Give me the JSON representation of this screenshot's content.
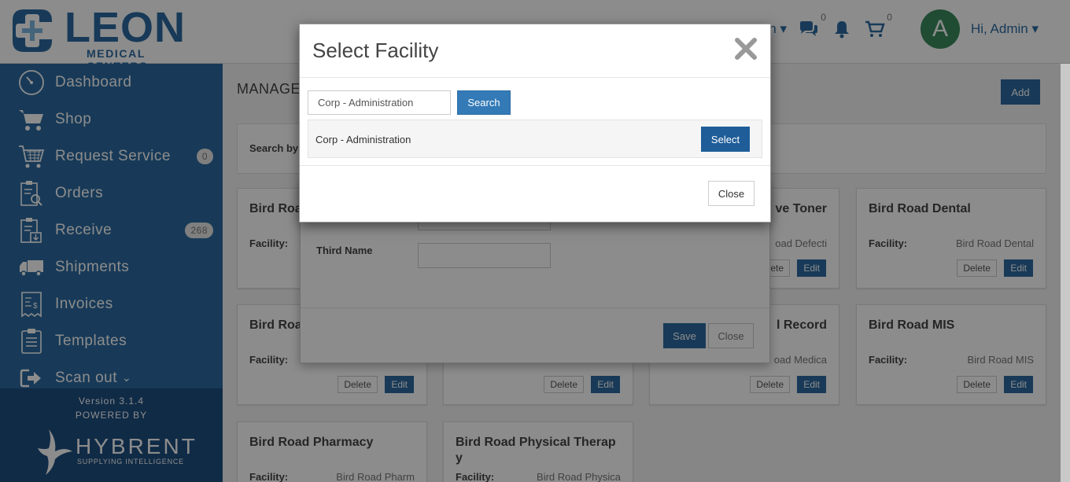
{
  "header": {
    "logo_word": "LEON",
    "logo_sub": "MEDICAL CENTERS",
    "partial_menu": "in",
    "messages_count": "0",
    "cart_count": "0",
    "avatar_letter": "A",
    "greeting": "Hi, Admin"
  },
  "sidebar": {
    "items": [
      {
        "label": "Dashboard",
        "icon": "dashboard-icon"
      },
      {
        "label": "Shop",
        "icon": "cart-icon"
      },
      {
        "label": "Request Service",
        "icon": "request-cart-icon",
        "badge": "0"
      },
      {
        "label": "Orders",
        "icon": "orders-icon"
      },
      {
        "label": "Receive",
        "icon": "receive-icon",
        "badge": "268"
      },
      {
        "label": "Shipments",
        "icon": "truck-icon"
      },
      {
        "label": "Invoices",
        "icon": "invoice-icon"
      },
      {
        "label": "Templates",
        "icon": "clipboard-icon"
      },
      {
        "label": "Scan out",
        "icon": "sign-out-icon"
      }
    ],
    "version": "Version 3.1.4",
    "powered_by": "POWERED BY",
    "hybrent": "HYBRENT",
    "hybrent_sub": "SUPPLYING INTELLIGENCE"
  },
  "main": {
    "title_partial": "MANAGE",
    "add_label": "Add",
    "search_label_partial": "Search by",
    "facility_label": "Facility:",
    "delete_label": "Delete",
    "edit_label": "Edit",
    "cards": [
      {
        "title": "Bird Roa",
        "facility": ""
      },
      {
        "title": "",
        "facility": ""
      },
      {
        "title": "ve Toner",
        "facility": "oad Defecti"
      },
      {
        "title": "Bird Road Dental",
        "facility": "Bird Road Dental"
      },
      {
        "title": "Bird Roa",
        "facility": ""
      },
      {
        "title": "",
        "facility": ""
      },
      {
        "title": "l Record",
        "facility": "oad Medica"
      },
      {
        "title": "Bird Road MIS",
        "facility": "Bird Road MIS"
      },
      {
        "title": "Bird Road Pharmacy",
        "facility": "Bird Road Pharm"
      },
      {
        "title": "Bird Road Physical Therap y",
        "facility": "Bird Road Physica"
      }
    ]
  },
  "bg_modal": {
    "third_name_label": "Third Name",
    "save_label": "Save",
    "close_label": "Close"
  },
  "modal": {
    "title": "Select Facility",
    "search_value": "Corp - Administration",
    "search_button": "Search",
    "result_label": "Corp - Administration",
    "select_button": "Select",
    "close_button": "Close"
  },
  "colors": {
    "brand": "#2c6aa0",
    "select_button": "#1f5d98",
    "search_button": "#337ab7"
  }
}
